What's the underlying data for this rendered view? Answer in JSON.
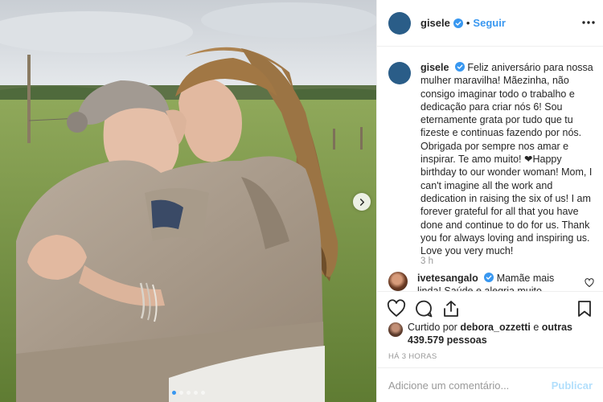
{
  "post": {
    "username": "gisele",
    "follow_label": "Seguir",
    "separator": "•",
    "caption": "Feliz aniversário para nossa mulher maravilha! Mãezinha, não consigo imaginar todo o trabalho e dedicação para criar nós 6! Sou eternamente grata por tudo que tu fizeste e continuas fazendo por nós. Obrigada por sempre nos amar e inspirar. Te amo muito! ❤Happy birthday to our wonder woman! Mom, I can't imagine all the work and dedication in raising the six of us! I am forever grateful for all that you have done and continue to do for us. Thank you for always loving and inspiring us. Love you very much!",
    "time_ago": "3 h",
    "comment": {
      "username": "ivetesangalo",
      "text": "Mamãe mais linda! Saúde e alegria muito..."
    },
    "likes": {
      "prefix": "Curtido por",
      "user": "debora_ozzetti",
      "middle": "e",
      "others": "outras 439.579 pessoas"
    },
    "timestamp": "HÁ 3 HORAS",
    "add_comment_placeholder": "Adicione um comentário...",
    "publish_label": "Publicar"
  },
  "carousel": {
    "slides": 5,
    "active": 0
  },
  "icons": {
    "heart": "heart-icon",
    "comment": "comment-icon",
    "share": "share-icon",
    "bookmark": "bookmark-icon",
    "more": "more-icon",
    "verified": "verified-badge-icon",
    "next": "chevron-right-icon"
  },
  "colors": {
    "link_blue": "#3897f0",
    "verified_blue": "#3897f0",
    "publish_disabled": "#b2dffc",
    "secondary_text": "#999999",
    "border": "#efefef"
  }
}
